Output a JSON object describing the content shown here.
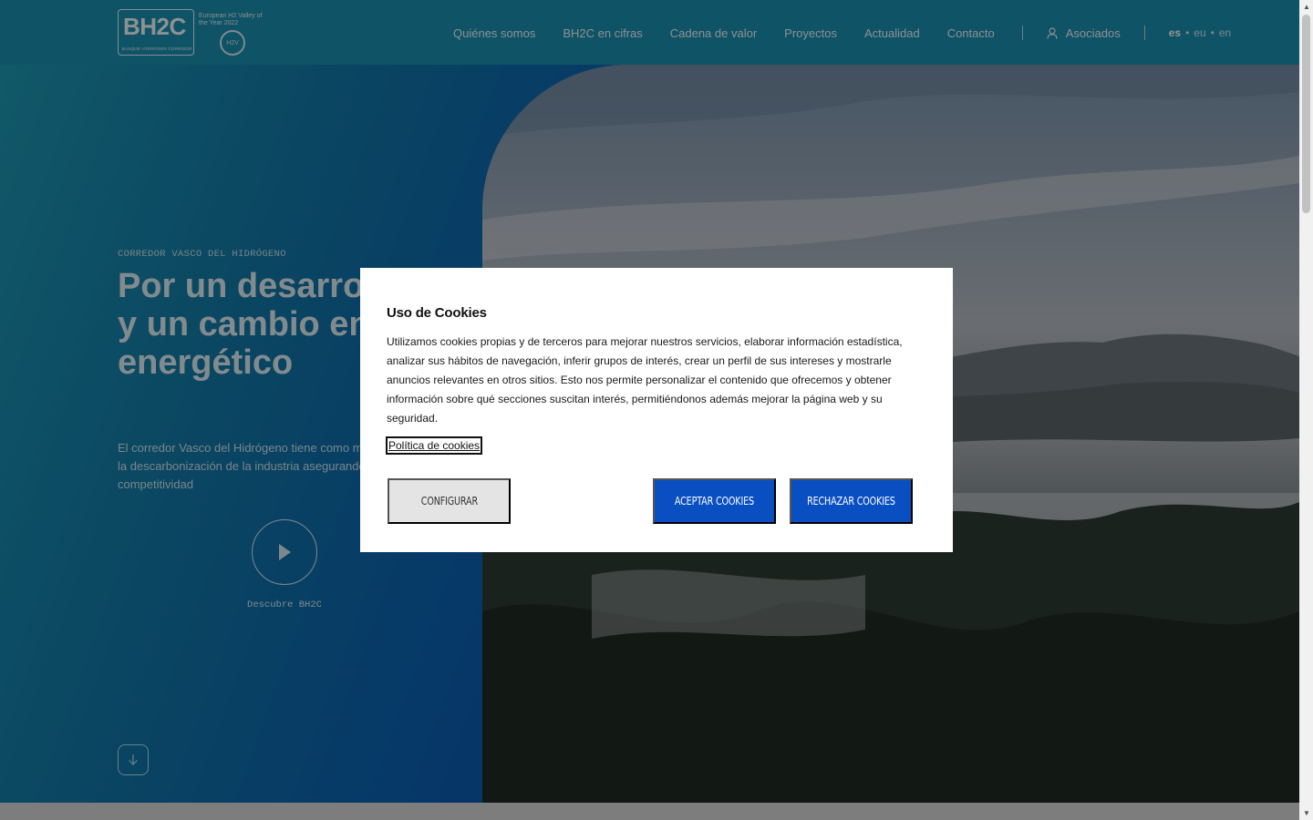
{
  "brand": {
    "logo_text": "BH2C",
    "logo_subtext": "BASQUE HYDROGEN CORRIDOR",
    "award_text": "European H2 Valley of the Year 2022",
    "award_badge": "H2V"
  },
  "nav": {
    "items": [
      "Quiénes somos",
      "BH2C en cifras",
      "Cadena de valor",
      "Proyectos",
      "Actualidad",
      "Contacto"
    ],
    "associates_label": "Asociados",
    "languages": [
      "es",
      "eu",
      "en"
    ],
    "active_language": "es"
  },
  "hero": {
    "eyebrow": "CORREDOR VASCO DEL HIDRÓGENO",
    "title": "Por un desarrollo tecnológico y un cambio en el modelo energético",
    "description": "El corredor Vasco del Hidrógeno tiene como misión la descarbonización de la industria asegurando su competitividad",
    "play_label": "Descubre BH2C"
  },
  "cookie_modal": {
    "title": "Uso de Cookies",
    "body": "Utilizamos cookies propias y de terceros para mejorar nuestros servicios, elaborar información estadística, analizar sus hábitos de navegación, inferir grupos de interés, crear un perfil de sus intereses y mostrarle anuncios relevantes en otros sitios. Esto nos permite personalizar el contenido que ofrecemos y obtener información sobre qué secciones suscitan interés, permitiéndonos además mejorar la página web y su seguridad.",
    "policy_link": "Política de cookies",
    "configure_label": "CONFIGURAR",
    "accept_label": "ACEPTAR COOKIES",
    "reject_label": "RECHAZAR COOKIES"
  },
  "colors": {
    "primary_button": "#0a4fc2",
    "header_bg": "#1a8fb0",
    "secondary_button": "#e4e4e4"
  }
}
